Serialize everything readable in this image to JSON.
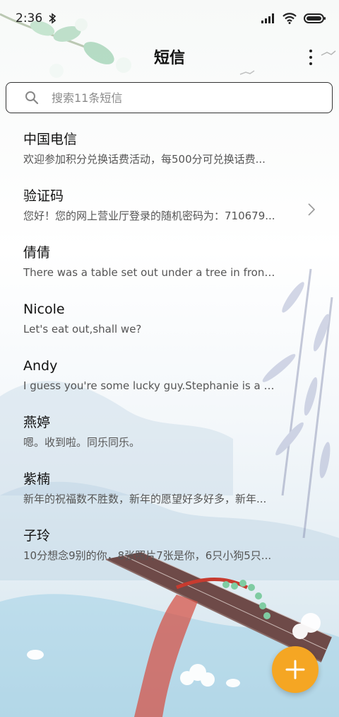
{
  "status_bar": {
    "time": "2:36",
    "icons": [
      "bluetooth-icon",
      "signal-icon",
      "wifi-icon",
      "battery-icon"
    ]
  },
  "header": {
    "title": "短信",
    "more_icon": "more-vertical-icon"
  },
  "search": {
    "placeholder": "搜索11条短信",
    "value": "",
    "icon": "search-icon"
  },
  "conversations": [
    {
      "name": "中国电信",
      "preview": "欢迎参加积分兑换话费活动，每500分可兑换话费..."
    },
    {
      "name": "验证码",
      "preview": "您好！您的网上营业厅登录的随机密码为：710679..."
    },
    {
      "name": "倩倩",
      "preview": "There was a table set out under a tree in front o..."
    },
    {
      "name": "Nicole",
      "preview": "Let's eat out,shall we?"
    },
    {
      "name": "Andy",
      "preview": "I guess you're some lucky guy.Stephanie is a ni..."
    },
    {
      "name": "燕婷",
      "preview": "嗯。收到啦。同乐同乐。"
    },
    {
      "name": "紫楠",
      "preview": "新年的祝福数不胜数，新年的愿望好多好多，新年..."
    },
    {
      "name": "子玲",
      "preview": "10分想念9别的你，8张照片7张是你，6只小狗5只..."
    }
  ],
  "fab": {
    "icon": "plus-icon",
    "color": "#f5a623"
  },
  "colors": {
    "accent": "#f5a623",
    "text_primary": "#111111",
    "text_secondary": "#555555"
  }
}
